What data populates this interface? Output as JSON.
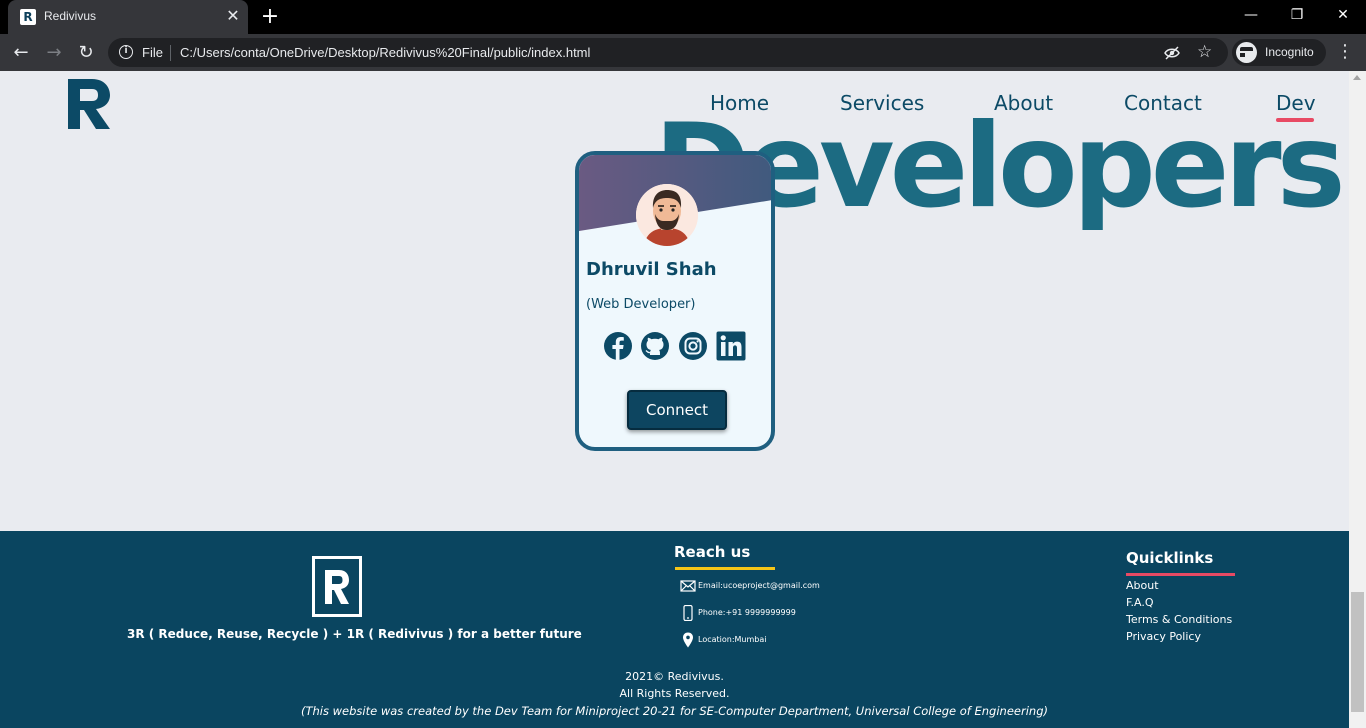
{
  "browser": {
    "tab_title": "Redivivus",
    "tab_close": "✕",
    "new_tab": "+",
    "scheme": "File",
    "url": "C:/Users/conta/OneDrive/Desktop/Redivivus%20Final/public/index.html",
    "incognito_label": "Incognito"
  },
  "nav": {
    "home": "Home",
    "services": "Services",
    "about": "About",
    "contact": "Contact",
    "dev": "Dev",
    "active": "Dev"
  },
  "hero": {
    "title": "Developers"
  },
  "card": {
    "name": "Dhruvil Shah",
    "role": "(Web Developer)",
    "socials": [
      "facebook-icon",
      "github-icon",
      "instagram-icon",
      "linkedin-icon"
    ],
    "connect_label": "Connect"
  },
  "footer": {
    "tagline": "3R ( Reduce, Reuse, Recycle ) + 1R ( Redivivus ) for a better future",
    "reach_title": "Reach us",
    "email": "Email:ucoeproject@gmail.com",
    "phone": "Phone:+91 9999999999",
    "location": "Location:Mumbai",
    "quick_title": "Quicklinks",
    "quick_links": [
      "About",
      "F.A.Q",
      "Terms & Conditions",
      "Privacy Policy"
    ],
    "copyright": "2021© Redivivus.",
    "rights": "All Rights Reserved.",
    "credit": "(This website was created by the Dev Team for Miniproject 20-21 for SE-Computer Department, Universal College of Engineering)"
  },
  "colors": {
    "brand_dark": "#0a4560",
    "brand_title": "#1c6b82",
    "accent_pink": "#e84a64",
    "accent_yellow": "#f5c518",
    "page_bg": "#e9ebf0"
  }
}
